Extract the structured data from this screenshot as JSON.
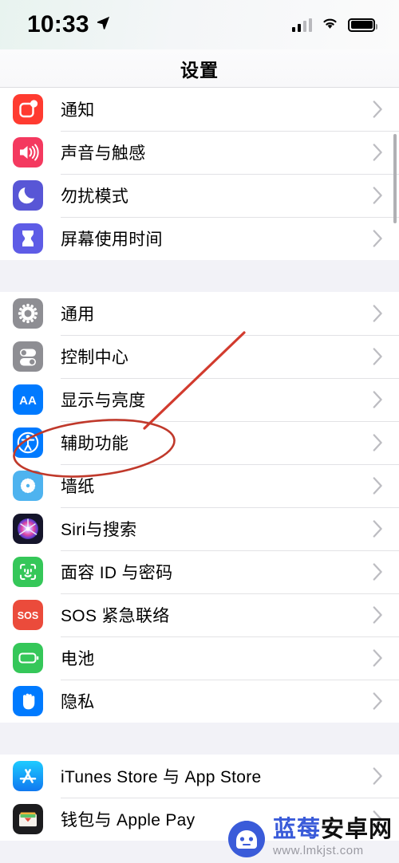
{
  "status_bar": {
    "time": "10:33",
    "location_icon": "location-arrow-icon",
    "signal_icon": "cellular-signal-icon",
    "wifi_icon": "wifi-icon",
    "battery_icon": "battery-full-icon"
  },
  "nav": {
    "title": "设置"
  },
  "groups": [
    {
      "rows": [
        {
          "label": "通知",
          "icon": "notifications-icon",
          "color": "#ff3b30",
          "chevron": "chevron-right-icon"
        },
        {
          "label": "声音与触感",
          "icon": "sounds-haptics-icon",
          "color": "#f4395f",
          "chevron": "chevron-right-icon"
        },
        {
          "label": "勿扰模式",
          "icon": "do-not-disturb-icon",
          "color": "#5856d6",
          "chevron": "chevron-right-icon"
        },
        {
          "label": "屏幕使用时间",
          "icon": "screen-time-icon",
          "color": "#5e5ce6",
          "chevron": "chevron-right-icon"
        }
      ]
    },
    {
      "rows": [
        {
          "label": "通用",
          "icon": "general-gear-icon",
          "color": "#8e8e93",
          "chevron": "chevron-right-icon"
        },
        {
          "label": "控制中心",
          "icon": "control-center-icon",
          "color": "#8e8e93",
          "chevron": "chevron-right-icon"
        },
        {
          "label": "显示与亮度",
          "icon": "display-brightness-icon",
          "color": "#007aff",
          "chevron": "chevron-right-icon"
        },
        {
          "label": "辅助功能",
          "icon": "accessibility-icon",
          "color": "#007aff",
          "chevron": "chevron-right-icon"
        },
        {
          "label": "墙纸",
          "icon": "wallpaper-icon",
          "color": "#4eb3ef",
          "chevron": "chevron-right-icon"
        },
        {
          "label": "Siri与搜索",
          "icon": "siri-search-icon",
          "color": "#1c1c2e",
          "chevron": "chevron-right-icon"
        },
        {
          "label": "面容 ID 与密码",
          "icon": "face-id-icon",
          "color": "#35c759",
          "chevron": "chevron-right-icon"
        },
        {
          "label": "SOS 紧急联络",
          "icon": "emergency-sos-icon",
          "color": "#eb4b3b",
          "chevron": "chevron-right-icon"
        },
        {
          "label": "电池",
          "icon": "battery-settings-icon",
          "color": "#35c759",
          "chevron": "chevron-right-icon"
        },
        {
          "label": "隐私",
          "icon": "privacy-hand-icon",
          "color": "#007aff",
          "chevron": "chevron-right-icon"
        }
      ]
    },
    {
      "rows": [
        {
          "label": "iTunes Store 与 App Store",
          "icon": "app-store-icon",
          "color": "#1aa3f0",
          "chevron": "chevron-right-icon"
        },
        {
          "label": "钱包与 Apple Pay",
          "icon": "wallet-apple-pay-icon",
          "color": "#1c1c1e",
          "chevron": "chevron-right-icon"
        }
      ]
    }
  ],
  "annotation": {
    "ellipse_target": "辅助功能",
    "color": "#d23b2e",
    "arrow_icon": "pointer-line-annotation",
    "ellipse_icon": "red-ellipse-annotation"
  },
  "watermark": {
    "brand_blue": "蓝莓",
    "brand_black": "安卓网",
    "url": "www.lmkjst.com",
    "logo_icon": "blueberry-android-robot-icon",
    "logo_color": "#3a5bd9"
  }
}
